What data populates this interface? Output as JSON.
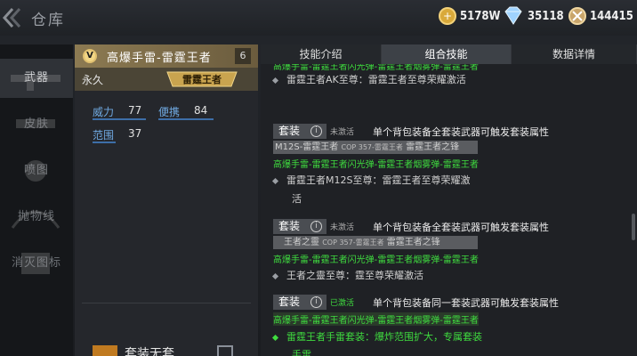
{
  "header": {
    "title": "仓库",
    "currencies": [
      {
        "icon": "gold-coin-plus-icon",
        "value": "5178W"
      },
      {
        "icon": "diamond-icon",
        "value": "35118"
      },
      {
        "icon": "honor-points-icon",
        "value": "144415"
      }
    ]
  },
  "sidebar": {
    "items": [
      {
        "label": "武器",
        "active": true
      },
      {
        "label": "皮肤",
        "active": false
      },
      {
        "label": "喷图",
        "active": false
      },
      {
        "label": "抛物线",
        "active": false
      },
      {
        "label": "消灭图标",
        "active": false
      }
    ]
  },
  "item": {
    "rank": "V",
    "name": "高爆手雷-雷霆王者",
    "slot": "6",
    "duration": "永久",
    "emblem_text": "雷霆王者",
    "stats": [
      {
        "label": "威力",
        "value": "77"
      },
      {
        "label": "便携",
        "value": "84"
      },
      {
        "label": "范围",
        "value": "37"
      }
    ],
    "set_option_label": "套装无套"
  },
  "tabs": [
    {
      "label": "技能介绍",
      "active": false
    },
    {
      "label": "组合技能",
      "active": true
    },
    {
      "label": "数据详情",
      "active": false
    }
  ],
  "content": {
    "top_partial_green": "高爆手雷-雷霆王者闪光弹-雷霆王者烟雾弹-雷霆王者",
    "ak_line": "雷霆王者AK至尊：雷霆王者至尊荣耀激活",
    "sets": [
      {
        "tag": "套装",
        "status": "未激活",
        "status_active": false,
        "desc": "单个背包装备全套装武器可触发套装属性",
        "weapon_line": "M12S-雷霆王者",
        "weapon_extra": "COP 357-雷霆王者",
        "weapon_third": "雷霆王者之锋",
        "green_line": "高爆手雷-雷霆王者闪光弹-雷霆王者烟雾弹-雷霆王者",
        "bullet_line_1": "雷霆王者M12S至尊：雷霆王者至尊荣耀激",
        "bullet_line_2": "活"
      },
      {
        "tag": "套装",
        "status": "未激活",
        "status_active": false,
        "desc": "单个背包装备全套装武器可触发套装属性",
        "weapon_line": "王者之靈",
        "weapon_extra": "COP 357-雷霆王者",
        "weapon_third": "雷霆王者之锋",
        "green_line": "高爆手雷-雷霆王者闪光弹-雷霆王者烟雾弹-雷霆王者",
        "bullet_line_1": "王者之靈至尊：霆至尊荣耀激活",
        "bullet_line_2": ""
      },
      {
        "tag": "套装",
        "status": "已激活",
        "status_active": true,
        "desc": "单个背包装备同一套装武器可触发套装属性",
        "green_line": "高爆手雷-雷霆王者闪光弹-雷霆王者烟雾弹-雷霆王者",
        "bullet_line_1": "雷霆王者手雷套装：爆炸范围扩大，专属套装",
        "bullet_line_2": "手雷"
      }
    ]
  }
}
